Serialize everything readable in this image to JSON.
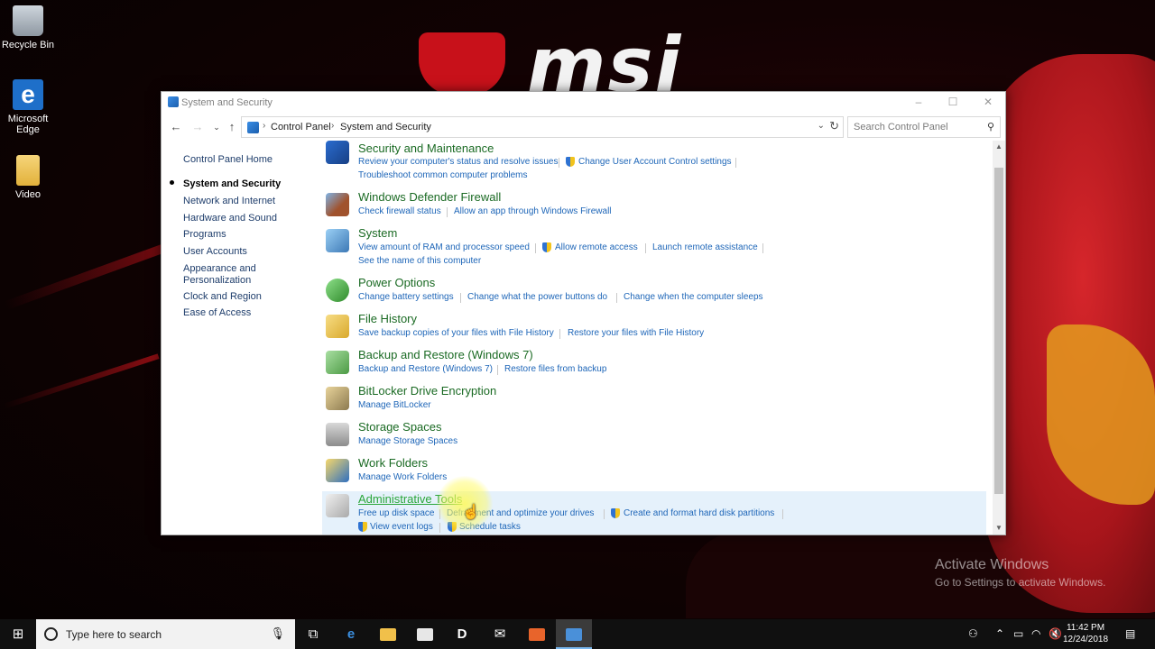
{
  "desktop": {
    "icons": [
      {
        "label": "Recycle Bin"
      },
      {
        "label": "Microsoft Edge"
      },
      {
        "label": "Video"
      }
    ],
    "wallpaper_text": "msi",
    "activation": {
      "line1": "Activate Windows",
      "line2": "Go to Settings to activate Windows."
    }
  },
  "window": {
    "title": "System and Security",
    "controls": {
      "minimize": "–",
      "maximize": "☐",
      "close": "✕"
    },
    "breadcrumb": [
      "Control Panel",
      "System and Security"
    ],
    "search_placeholder": "Search Control Panel",
    "sidebar": {
      "home": "Control Panel Home",
      "items": [
        {
          "label": "System and Security",
          "active": true
        },
        {
          "label": "Network and Internet"
        },
        {
          "label": "Hardware and Sound"
        },
        {
          "label": "Programs"
        },
        {
          "label": "User Accounts"
        },
        {
          "label": "Appearance and Personalization"
        },
        {
          "label": "Clock and Region"
        },
        {
          "label": "Ease of Access"
        }
      ]
    },
    "sections": [
      {
        "title": "Security and Maintenance",
        "icon": "flag-icon",
        "links": [
          {
            "text": "Review your computer's status and resolve issues"
          },
          {
            "text": "Change User Account Control settings",
            "shield": true
          },
          {
            "text": "Troubleshoot common computer problems"
          }
        ]
      },
      {
        "title": "Windows Defender Firewall",
        "icon": "firewall-icon",
        "links": [
          {
            "text": "Check firewall status"
          },
          {
            "text": "Allow an app through Windows Firewall"
          }
        ]
      },
      {
        "title": "System",
        "icon": "computer-icon",
        "links": [
          {
            "text": "View amount of RAM and processor speed"
          },
          {
            "text": "Allow remote access",
            "shield": true
          },
          {
            "text": "Launch remote assistance"
          },
          {
            "text": "See the name of this computer"
          }
        ]
      },
      {
        "title": "Power Options",
        "icon": "battery-icon",
        "links": [
          {
            "text": "Change battery settings"
          },
          {
            "text": "Change what the power buttons do"
          },
          {
            "text": "Change when the computer sleeps"
          }
        ]
      },
      {
        "title": "File History",
        "icon": "file-history-icon",
        "links": [
          {
            "text": "Save backup copies of your files with File History"
          },
          {
            "text": "Restore your files with File History"
          }
        ]
      },
      {
        "title": "Backup and Restore (Windows 7)",
        "icon": "backup-icon",
        "links": [
          {
            "text": "Backup and Restore (Windows 7)"
          },
          {
            "text": "Restore files from backup"
          }
        ]
      },
      {
        "title": "BitLocker Drive Encryption",
        "icon": "bitlocker-icon",
        "links": [
          {
            "text": "Manage BitLocker"
          }
        ]
      },
      {
        "title": "Storage Spaces",
        "icon": "storage-icon",
        "links": [
          {
            "text": "Manage Storage Spaces"
          }
        ]
      },
      {
        "title": "Work Folders",
        "icon": "folders-icon",
        "links": [
          {
            "text": "Manage Work Folders"
          }
        ]
      },
      {
        "title": "Administrative Tools",
        "icon": "admin-tools-icon",
        "highlighted": true,
        "links": [
          {
            "text": "Free up disk space"
          },
          {
            "text": "Defragment and optimize your drives"
          },
          {
            "text": "Create and format hard disk partitions",
            "shield": true
          },
          {
            "text": "View event logs",
            "shield": true
          },
          {
            "text": "Schedule tasks",
            "shield": true
          }
        ]
      }
    ]
  },
  "taskbar": {
    "search_placeholder": "Type here to search",
    "apps": [
      "task-view-icon",
      "edge-icon",
      "file-explorer-icon",
      "store-icon",
      "app-d-icon",
      "mail-icon",
      "office-icon",
      "control-panel-icon"
    ],
    "time": "11:42 PM",
    "date": "12/24/2018"
  }
}
